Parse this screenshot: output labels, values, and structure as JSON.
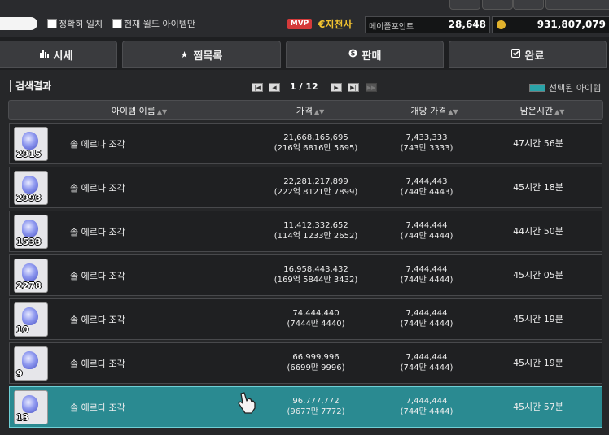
{
  "toolbar": {
    "exact_match_label": "정확히 일치",
    "current_world_label": "현재 월드 아이템만",
    "mvp_badge": "MVP",
    "reboot_symbol": "€",
    "server_name": "지천사",
    "maple_points_label": "메이플포인트",
    "maple_points_value": "28,648",
    "meso_value": "931,807,079"
  },
  "tabs": [
    {
      "label": "시세",
      "icon": "bar-chart-icon"
    },
    {
      "label": "찜목록",
      "icon": "star-icon"
    },
    {
      "label": "판매",
      "icon": "coin-icon"
    },
    {
      "label": "완료",
      "icon": "checkbox-icon"
    }
  ],
  "results": {
    "title": "검색결과",
    "page_current": "1",
    "page_sep": "/",
    "page_total": "12",
    "selected_legend": "선택된 아이템"
  },
  "columns": {
    "name": "아이템 이름",
    "price": "가격",
    "unit_price": "개당 가격",
    "time_left": "남은시간"
  },
  "rows": [
    {
      "qty": "2915",
      "name": "솔 에르다 조각",
      "price": "21,668,165,695",
      "price_kr": "(216억 6816만 5695)",
      "unit": "7,433,333",
      "unit_kr": "(743만 3333)",
      "time": "47시간 56분",
      "selected": false
    },
    {
      "qty": "2993",
      "name": "솔 에르다 조각",
      "price": "22,281,217,899",
      "price_kr": "(222억 8121만 7899)",
      "unit": "7,444,443",
      "unit_kr": "(744만 4443)",
      "time": "45시간 18분",
      "selected": false
    },
    {
      "qty": "1533",
      "name": "솔 에르다 조각",
      "price": "11,412,332,652",
      "price_kr": "(114억 1233만 2652)",
      "unit": "7,444,444",
      "unit_kr": "(744만 4444)",
      "time": "44시간 50분",
      "selected": false
    },
    {
      "qty": "2278",
      "name": "솔 에르다 조각",
      "price": "16,958,443,432",
      "price_kr": "(169억 5844만 3432)",
      "unit": "7,444,444",
      "unit_kr": "(744만 4444)",
      "time": "45시간 05분",
      "selected": false
    },
    {
      "qty": "10",
      "name": "솔 에르다 조각",
      "price": "74,444,440",
      "price_kr": "(7444만 4440)",
      "unit": "7,444,444",
      "unit_kr": "(744만 4444)",
      "time": "45시간 19분",
      "selected": false
    },
    {
      "qty": "9",
      "name": "솔 에르다 조각",
      "price": "66,999,996",
      "price_kr": "(6699만 9996)",
      "unit": "7,444,444",
      "unit_kr": "(744만 4444)",
      "time": "45시간 19분",
      "selected": false
    },
    {
      "qty": "13",
      "name": "솔 에르다 조각",
      "price": "96,777,772",
      "price_kr": "(9677만 7772)",
      "unit": "7,444,444",
      "unit_kr": "(744만 4444)",
      "time": "45시간 57분",
      "selected": true
    }
  ],
  "colors": {
    "selected_row": "#2a8a91",
    "accent_gold": "#f1c230",
    "mvp_red": "#d43a3a"
  }
}
